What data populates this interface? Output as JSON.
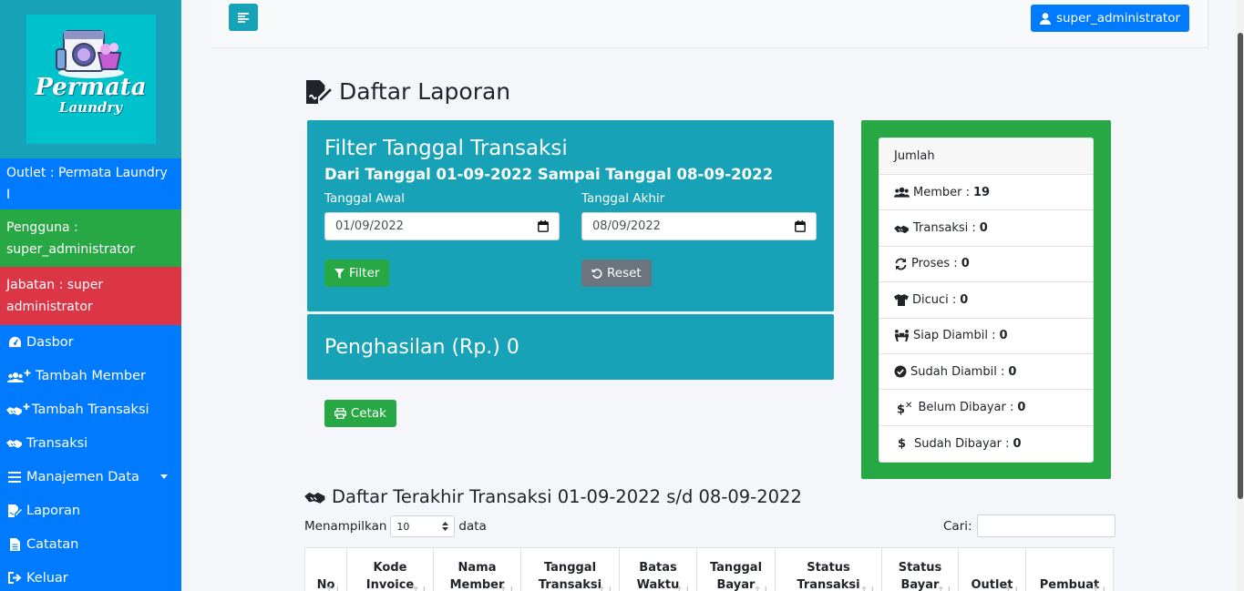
{
  "brand": {
    "logo_line1": "Permata",
    "logo_line2": "Laundry"
  },
  "sidebar": {
    "outlet": "Outlet : Permata Laundry I",
    "user_label": "Pengguna :",
    "user_value": "super_administrator",
    "role_label": "Jabatan : super",
    "role_value": "administrator",
    "items": [
      {
        "label": "Dasbor",
        "icon": "gauge-icon"
      },
      {
        "label": "Tambah Member",
        "icon": "users-plus-icon"
      },
      {
        "label": "Tambah Transaksi",
        "icon": "handshake-plus-icon"
      },
      {
        "label": "Transaksi",
        "icon": "handshake-icon"
      },
      {
        "label": "Manajemen Data",
        "icon": "list-icon"
      },
      {
        "label": "Laporan",
        "icon": "file-signature-icon"
      },
      {
        "label": "Catatan",
        "icon": "file-alt-icon"
      },
      {
        "label": "Keluar",
        "icon": "sign-out-icon"
      }
    ]
  },
  "header": {
    "user_button": "super_administrator"
  },
  "page": {
    "title": "Daftar Laporan"
  },
  "filter": {
    "title": "Filter Tanggal Transaksi",
    "range_text": "Dari Tanggal 01-09-2022 Sampai Tanggal 08-09-2022",
    "start_label": "Tanggal Awal",
    "start_value": "01/09/2022",
    "end_label": "Tanggal Akhir",
    "end_value": "08/09/2022",
    "filter_button": "Filter",
    "reset_button": "Reset"
  },
  "income": {
    "text": "Penghasilan (Rp.) 0"
  },
  "print_button": "Cetak",
  "summary": {
    "header": "Jumlah",
    "rows": [
      {
        "label": "Member :",
        "value": "19",
        "icon": "users-icon"
      },
      {
        "label": "Transaksi :",
        "value": "0",
        "icon": "handshake-icon"
      },
      {
        "label": "Proses :",
        "value": "0",
        "icon": "sync-icon"
      },
      {
        "label": "Dicuci :",
        "value": "0",
        "icon": "tshirt-icon"
      },
      {
        "label": "Siap Diambil :",
        "value": "0",
        "icon": "people-carry-icon"
      },
      {
        "label": "Sudah Diambil :",
        "value": "0",
        "icon": "check-circle-icon"
      },
      {
        "label": "Belum Dibayar :",
        "value": "0",
        "icon": "dollar-times-icon"
      },
      {
        "label": "Sudah Dibayar :",
        "value": "0",
        "icon": "dollar-icon"
      }
    ]
  },
  "recent": {
    "title": "Daftar Terakhir Transaksi 01-09-2022 s/d 08-09-2022",
    "show_label": "Menampilkan",
    "show_value": "10",
    "show_suffix": "data",
    "search_label": "Cari:",
    "columns": [
      {
        "l1": "No",
        "l2": ""
      },
      {
        "l1": "Kode",
        "l2": "Invoice"
      },
      {
        "l1": "Nama",
        "l2": "Member"
      },
      {
        "l1": "Tanggal",
        "l2": "Transaksi"
      },
      {
        "l1": "Batas",
        "l2": "Waktu"
      },
      {
        "l1": "Tanggal",
        "l2": "Bayar"
      },
      {
        "l1": "Status",
        "l2": "Transaksi"
      },
      {
        "l1": "Status",
        "l2": "Bayar"
      },
      {
        "l1": "Outlet",
        "l2": ""
      },
      {
        "l1": "Pembuat",
        "l2": ""
      }
    ]
  }
}
